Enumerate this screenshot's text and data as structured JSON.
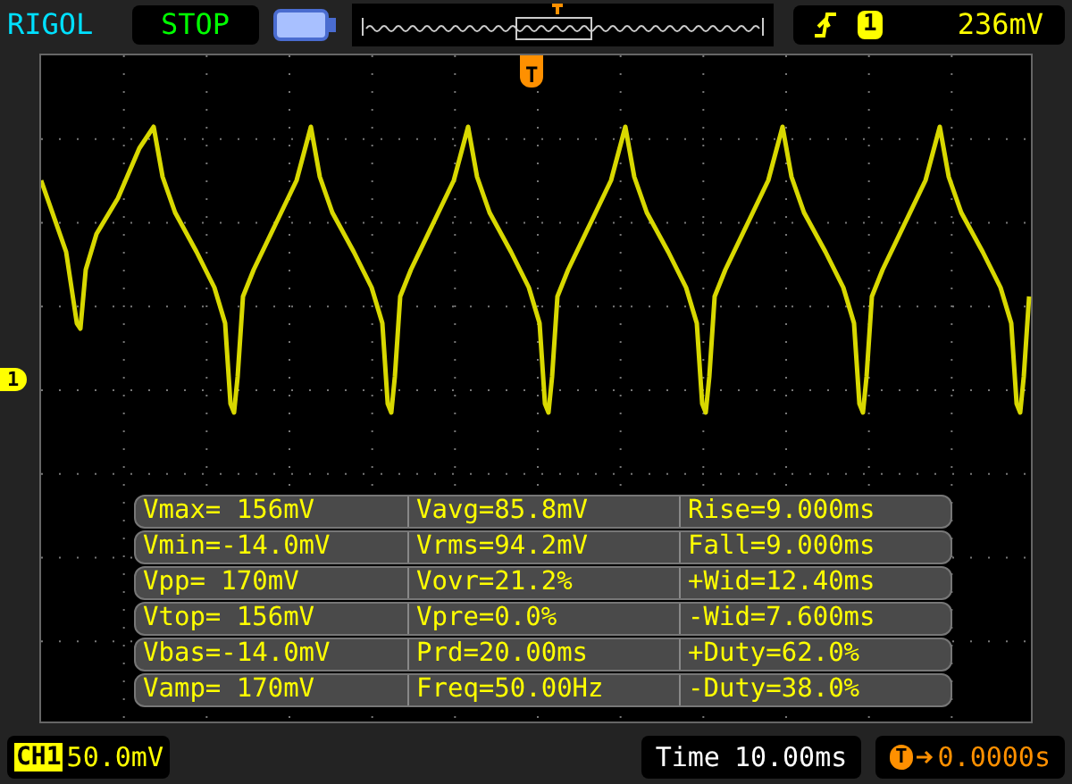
{
  "header": {
    "brand": "RIGOL",
    "run_state": "STOP",
    "trigger": {
      "channel": "1",
      "level": "236mV"
    }
  },
  "screen": {
    "trigger_marker": "T",
    "channel_marker": "1"
  },
  "measurements": [
    [
      "Vmax= 156mV",
      "Vavg=85.8mV",
      "Rise=9.000ms"
    ],
    [
      "Vmin=-14.0mV",
      "Vrms=94.2mV",
      "Fall=9.000ms"
    ],
    [
      "Vpp= 170mV",
      "Vovr=21.2%",
      "+Wid=12.40ms"
    ],
    [
      "Vtop= 156mV",
      "Vpre=0.0%",
      "-Wid=7.600ms"
    ],
    [
      "Vbas=-14.0mV",
      "Prd=20.00ms",
      "+Duty=62.0%"
    ],
    [
      "Vamp= 170mV",
      "Freq=50.00Hz",
      "-Duty=38.0%"
    ]
  ],
  "footer": {
    "channel": "CH1",
    "scale": "50.0mV",
    "time_label": "Time",
    "time_value": "10.00ms",
    "offset_marker": "T",
    "offset": "0.0000s"
  }
}
